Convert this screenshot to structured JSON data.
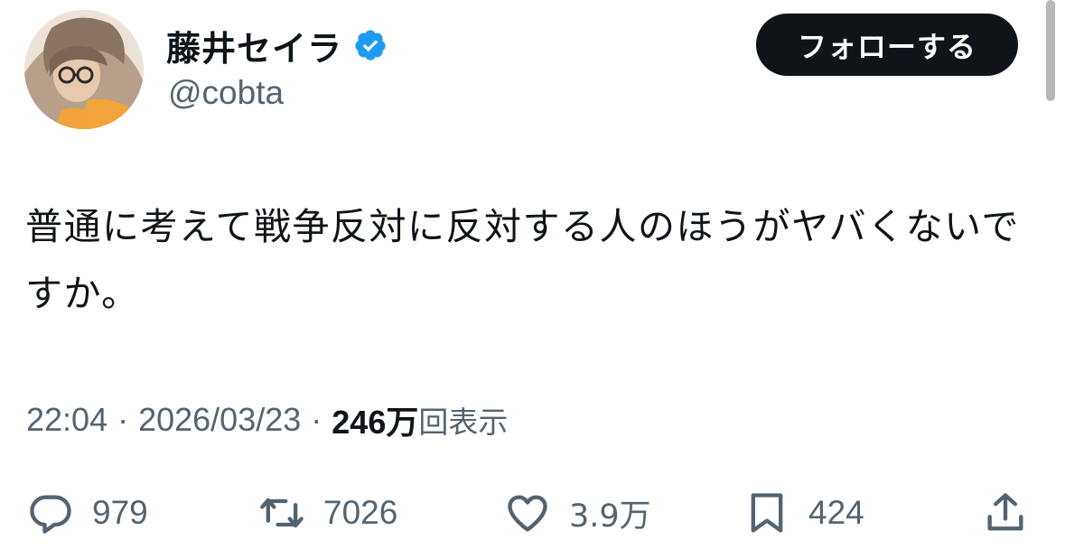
{
  "author": {
    "display_name": "藤井セイラ",
    "handle": "@cobta",
    "verified_color": "#1d9bf0",
    "avatar_icon": "profile-photo"
  },
  "follow_button": {
    "label": "フォローする",
    "bg_color": "#0f1419",
    "text_color": "#ffffff"
  },
  "tweet": {
    "text": "普通に考えて戦争反対に反対する人のほうがヤバくないですか。"
  },
  "meta": {
    "time": "22:04",
    "separator": "·",
    "date": "2026/03/23",
    "views_count": "246万",
    "views_label": "回表示"
  },
  "actions": {
    "reply": {
      "icon": "reply-icon",
      "count": "979"
    },
    "repost": {
      "icon": "repost-icon",
      "count": "7026"
    },
    "like": {
      "icon": "like-icon",
      "count": "3.9万"
    },
    "bookmark": {
      "icon": "bookmark-icon",
      "count": "424"
    },
    "share": {
      "icon": "share-icon"
    }
  },
  "colors": {
    "text_primary": "#0f1419",
    "text_secondary": "#536471",
    "background": "#ffffff"
  }
}
